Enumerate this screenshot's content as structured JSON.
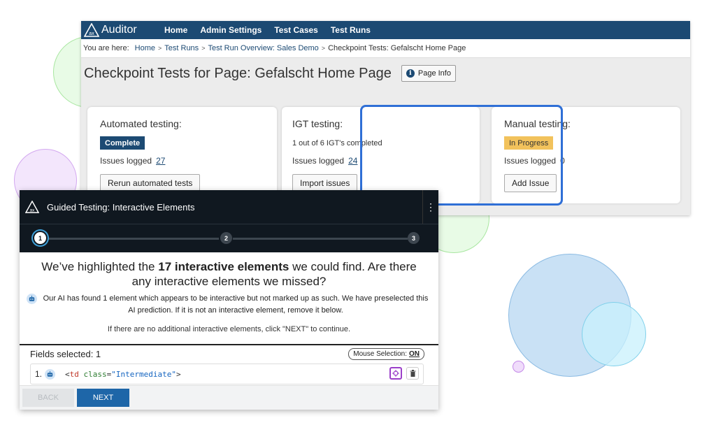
{
  "colors": {
    "nav_bg": "#1c4a73",
    "panel_bg": "#101820",
    "accent_blue": "#2f6fd6",
    "progress_badge": "#f2c25c",
    "next_button": "#1e66a8"
  },
  "nav": {
    "logo_text": "Auditor",
    "logo_mark": "ax",
    "items": [
      {
        "label": "Home"
      },
      {
        "label": "Admin Settings"
      },
      {
        "label": "Test Cases"
      },
      {
        "label": "Test Runs"
      }
    ]
  },
  "breadcrumb": {
    "label": "You are here:",
    "links": [
      {
        "label": "Home"
      },
      {
        "label": "Test Runs"
      },
      {
        "label": "Test Run Overview: Sales Demo"
      }
    ],
    "current": "Checkpoint Tests: Gefalscht Home Page",
    "separator": ">"
  },
  "page": {
    "title": "Checkpoint Tests for Page: Gefalscht Home Page",
    "info_button": "Page Info",
    "info_icon": "info-icon"
  },
  "cards": {
    "automated": {
      "title": "Automated testing:",
      "status": "Complete",
      "issues_label": "Issues logged",
      "issues_count": "27",
      "button": "Rerun automated tests"
    },
    "igt": {
      "title": "IGT testing:",
      "progress_text": "1 out of 6 IGT's completed",
      "issues_label": "Issues logged",
      "issues_count": "24",
      "button": "Import issues"
    },
    "manual": {
      "title": "Manual testing:",
      "status": "In Progress",
      "issues_label": "Issues logged",
      "issues_count": "0",
      "button": "Add Issue"
    }
  },
  "guided": {
    "title": "Guided Testing: Interactive Elements",
    "menu_icon": "⋮",
    "steps": [
      {
        "label": "1"
      },
      {
        "label": "2"
      },
      {
        "label": "3"
      }
    ],
    "question_pre": "We’ve highlighted the ",
    "question_bold": "17 interactive elements",
    "question_post": " we could find. Are there any interactive elements we missed?",
    "ai_note": "Our AI has found 1 element which appears to be interactive but not marked up as such. We have preselected this AI prediction. If it is not an interactive element, remove it below.",
    "continue_note": "If there are no additional interactive elements, click \"NEXT\" to continue.",
    "fields_label": "Fields selected: 1",
    "mouse_selection_label": "Mouse Selection:",
    "mouse_selection_value": "ON",
    "rows": [
      {
        "num": "1.",
        "tag_open": "<",
        "tag": "td",
        "attr": "class",
        "eq": "=",
        "value": "\"Intermediate\"",
        "tag_close": ">"
      }
    ],
    "back_label": "BACK",
    "next_label": "NEXT"
  }
}
